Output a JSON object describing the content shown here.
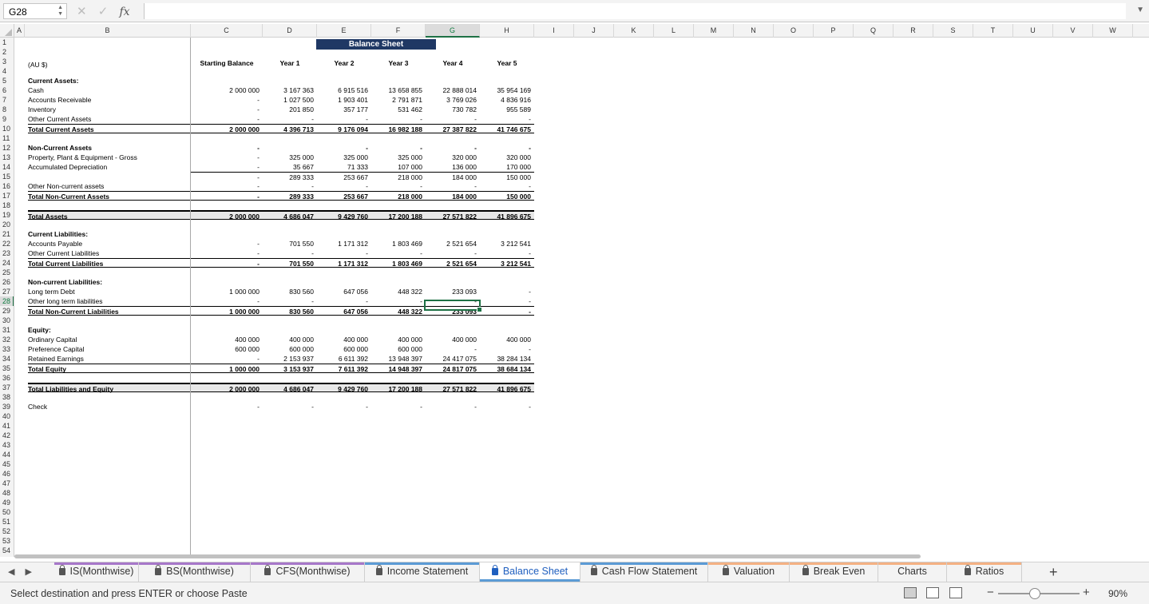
{
  "formula_bar": {
    "name_box": "G28",
    "cancel_icon": "✕",
    "enter_icon": "✓",
    "fx_label": "fx",
    "formula": ""
  },
  "columns": [
    "A",
    "B",
    "C",
    "D",
    "E",
    "F",
    "G",
    "H",
    "I",
    "J",
    "K",
    "L",
    "M",
    "N",
    "O",
    "P",
    "Q",
    "R",
    "S",
    "T",
    "U",
    "V",
    "W"
  ],
  "rows_count": 54,
  "sheet": {
    "title": "Balance Sheet",
    "currency_label": "(AU $)",
    "headers": [
      "Starting Balance",
      "Year 1",
      "Year 2",
      "Year 3",
      "Year 4",
      "Year 5"
    ],
    "lines": [
      {
        "row": 5,
        "label": "Current Assets:",
        "bold": true,
        "values": []
      },
      {
        "row": 6,
        "label": "Cash",
        "values": [
          "2 000 000",
          "3 167 363",
          "6 915 516",
          "13 658 855",
          "22 888 014",
          "35 954 169"
        ]
      },
      {
        "row": 7,
        "label": "Accounts Receivable",
        "values": [
          "-",
          "1 027 500",
          "1 903 401",
          "2 791 871",
          "3 769 026",
          "4 836 916"
        ]
      },
      {
        "row": 8,
        "label": "Inventory",
        "values": [
          "-",
          "201 850",
          "357 177",
          "531 462",
          "730 782",
          "955 589"
        ]
      },
      {
        "row": 9,
        "label": "Other Current Assets",
        "values": [
          "-",
          "-",
          "-",
          "-",
          "-",
          "-"
        ]
      },
      {
        "row": 10,
        "label": "Total Current Assets",
        "bold": true,
        "total": 1,
        "values": [
          "2 000 000",
          "4 396 713",
          "9 176 094",
          "16 982 188",
          "27 387 822",
          "41 746 675"
        ]
      },
      {
        "row": 12,
        "label": "Non-Current Assets",
        "bold": true,
        "values": [
          "-",
          "",
          "-",
          "-",
          "-",
          "-"
        ]
      },
      {
        "row": 13,
        "label": "Property, Plant & Equipment - Gross",
        "values": [
          "-",
          "325 000",
          "325 000",
          "325 000",
          "320 000",
          "320 000"
        ]
      },
      {
        "row": 14,
        "label": "Accumulated Depreciation",
        "values": [
          "-",
          "35 667",
          "71 333",
          "107 000",
          "136 000",
          "170 000"
        ]
      },
      {
        "row": 15,
        "label": "",
        "topline": true,
        "values": [
          "-",
          "289 333",
          "253 667",
          "218 000",
          "184 000",
          "150 000"
        ]
      },
      {
        "row": 16,
        "label": "Other Non-current assets",
        "values": [
          "-",
          "-",
          "-",
          "-",
          "-",
          "-"
        ]
      },
      {
        "row": 17,
        "label": "Total Non-Current Assets",
        "bold": true,
        "total": 1,
        "values": [
          "-",
          "289 333",
          "253 667",
          "218 000",
          "184 000",
          "150 000"
        ]
      },
      {
        "row": 19,
        "label": "Total Assets",
        "bold": true,
        "total": 2,
        "values": [
          "2 000 000",
          "4 686 047",
          "9 429 760",
          "17 200 188",
          "27 571 822",
          "41 896 675"
        ]
      },
      {
        "row": 21,
        "label": "Current Liabilities:",
        "bold": true,
        "values": []
      },
      {
        "row": 22,
        "label": "Accounts Payable",
        "values": [
          "-",
          "701 550",
          "1 171 312",
          "1 803 469",
          "2 521 654",
          "3 212 541"
        ]
      },
      {
        "row": 23,
        "label": "Other Current Liabilities",
        "values": [
          "-",
          "-",
          "-",
          "-",
          "-",
          "-"
        ]
      },
      {
        "row": 24,
        "label": "Total Current Liabilities",
        "bold": true,
        "total": 1,
        "values": [
          "-",
          "701 550",
          "1 171 312",
          "1 803 469",
          "2 521 654",
          "3 212 541"
        ]
      },
      {
        "row": 26,
        "label": "Non-current Liabilities:",
        "bold": true,
        "values": []
      },
      {
        "row": 27,
        "label": "Long term Debt",
        "values": [
          "1 000 000",
          "830 560",
          "647 056",
          "448 322",
          "233 093",
          "-"
        ]
      },
      {
        "row": 28,
        "label": "Other long term liabilities",
        "values": [
          "-",
          "-",
          "-",
          "-",
          "-",
          "-"
        ]
      },
      {
        "row": 29,
        "label": "Total Non-Current Liabilities",
        "bold": true,
        "total": 1,
        "values": [
          "1 000 000",
          "830 560",
          "647 056",
          "448 322",
          "233 093",
          "-"
        ]
      },
      {
        "row": 31,
        "label": "Equity:",
        "bold": true,
        "values": []
      },
      {
        "row": 32,
        "label": "Ordinary Capital",
        "values": [
          "400 000",
          "400 000",
          "400 000",
          "400 000",
          "400 000",
          "400 000"
        ]
      },
      {
        "row": 33,
        "label": "Preference Capital",
        "values": [
          "600 000",
          "600 000",
          "600 000",
          "600 000",
          "-",
          "-"
        ]
      },
      {
        "row": 34,
        "label": "Retained Earnings",
        "values": [
          "-",
          "2 153 937",
          "6 611 392",
          "13 948 397",
          "24 417 075",
          "38 284 134"
        ]
      },
      {
        "row": 35,
        "label": "Total Equity",
        "bold": true,
        "total": 1,
        "values": [
          "1 000 000",
          "3 153 937",
          "7 611 392",
          "14 948 397",
          "24 817 075",
          "38 684 134"
        ]
      },
      {
        "row": 37,
        "label": "Total Liabilities and Equity",
        "bold": true,
        "total": 2,
        "values": [
          "2 000 000",
          "4 686 047",
          "9 429 760",
          "17 200 188",
          "27 571 822",
          "41 896 675"
        ]
      },
      {
        "row": 39,
        "label": "Check",
        "values": [
          "-",
          "-",
          "-",
          "-",
          "-",
          "-"
        ]
      }
    ]
  },
  "tabs": [
    {
      "label": "IS(Monthwise)",
      "locked": true,
      "color": "#a777c9"
    },
    {
      "label": "BS(Monthwise)",
      "locked": true,
      "color": "#a777c9"
    },
    {
      "label": "CFS(Monthwise)",
      "locked": true,
      "color": "#a777c9"
    },
    {
      "label": "Income Statement",
      "locked": true,
      "color": "#5b9bd5"
    },
    {
      "label": "Balance Sheet",
      "locked": true,
      "color": "#5b9bd5",
      "active": true
    },
    {
      "label": "Cash Flow Statement",
      "locked": true,
      "color": "#5b9bd5"
    },
    {
      "label": "Valuation",
      "locked": true,
      "color": "#f4b183"
    },
    {
      "label": "Break Even",
      "locked": true,
      "color": "#f4b183"
    },
    {
      "label": "Charts",
      "locked": false,
      "color": "#f4b183"
    },
    {
      "label": "Ratios",
      "locked": true,
      "color": "#f4b183"
    }
  ],
  "status": {
    "message": "Select destination and press ENTER or choose Paste",
    "zoom": "90%",
    "zoom_level": 0.45
  }
}
